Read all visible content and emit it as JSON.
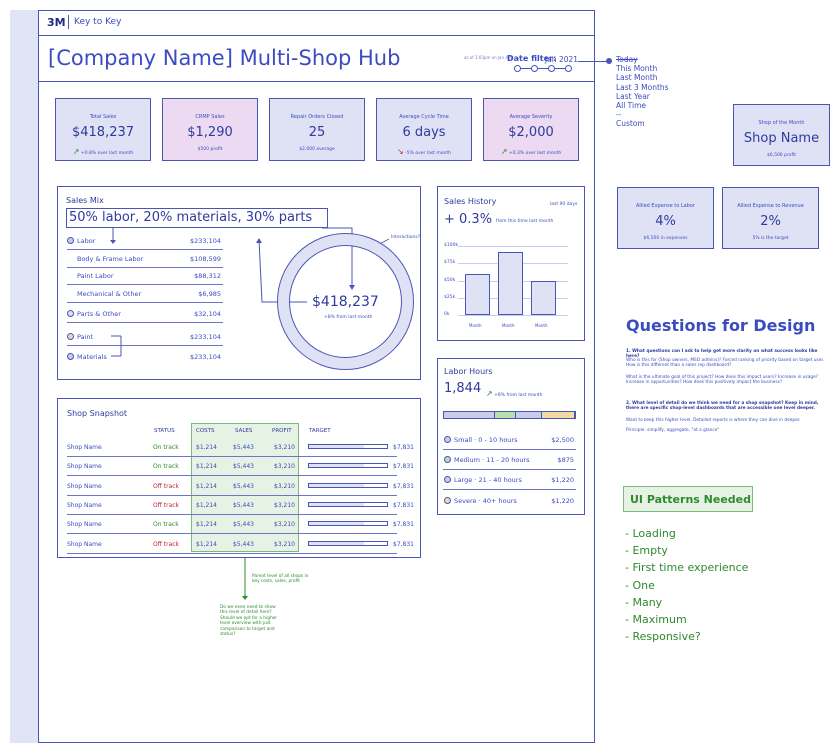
{
  "header": {
    "brand": "3M",
    "subtitle": "Key to Key"
  },
  "hub": {
    "title": "[Company Name] Multi-Shop Hub"
  },
  "date_filter": {
    "hint": "as of 3:03pm on Jan 4th",
    "label": "Date filter:",
    "value": "Jan 2021",
    "options": [
      "Today",
      "This Month",
      "Last Month",
      "Last 3 Months",
      "Last Year",
      "All Time",
      "--",
      "Custom"
    ]
  },
  "kpis": [
    {
      "label": "Total Sales",
      "value": "$418,237",
      "sub": "+0.8% over last month",
      "trend": "up"
    },
    {
      "label": "CRMP Sales",
      "value": "$1,290",
      "sub": "$500 profit",
      "trend": ""
    },
    {
      "label": "Repair Orders Closed",
      "value": "25",
      "sub": "$2,000 average",
      "trend": ""
    },
    {
      "label": "Average Cycle Time",
      "value": "6 days",
      "sub": "-5% over last month",
      "trend": "down"
    },
    {
      "label": "Average Severity",
      "value": "$2,000",
      "sub": "+0.3% over last month",
      "trend": "up"
    }
  ],
  "side_kpis": [
    {
      "label": "Shop of the Month",
      "value": "Shop Name",
      "sub": "$6,500 profit"
    },
    {
      "label": "Allied Expense to Labor",
      "value": "4%",
      "sub": "$6,500 in expenses"
    },
    {
      "label": "Allied Expense to Revenue",
      "value": "2%",
      "sub": "5% is the target"
    }
  ],
  "sales_mix": {
    "title": "Sales Mix",
    "headline": "50% labor, 20% materials, 30% parts",
    "rows": [
      {
        "label": "Labor",
        "value": "$233,104"
      },
      {
        "label": "Body & Frame Labor",
        "value": "$108,599"
      },
      {
        "label": "Paint Labor",
        "value": "$88,312"
      },
      {
        "label": "Mechanical & Other",
        "value": "$6,985"
      },
      {
        "label": "Parts & Other",
        "value": "$32,104"
      },
      {
        "label": "Paint",
        "value": "$233,104"
      },
      {
        "label": "Materials",
        "value": "$233,104"
      }
    ],
    "total": "$418,237",
    "total_sub": "+8% from last month",
    "note": "Interactions?"
  },
  "sales_history": {
    "title": "Sales History",
    "range": "last 90 days",
    "value": "+ 0.3%",
    "sub": "from this time last month",
    "yticks": [
      "$100k",
      "$75k",
      "$50k",
      "$25k",
      "0k"
    ],
    "chart_data": {
      "type": "bar",
      "categories": [
        "Month",
        "Month",
        "Month"
      ],
      "values": [
        60,
        92,
        50
      ],
      "ylim": [
        0,
        100
      ],
      "ylabel": "",
      "xlabel": ""
    }
  },
  "labor_hours": {
    "title": "Labor Hours",
    "value": "1,844",
    "sub": "+8% from last month",
    "segments": [
      {
        "color": "#c9cdeb",
        "share": 0.39
      },
      {
        "color": "#b7e0b0",
        "share": 0.16
      },
      {
        "color": "#c9cdeb",
        "share": 0.2
      },
      {
        "color": "#f3d9a6",
        "share": 0.25
      }
    ],
    "rows": [
      {
        "label": "Small",
        "range": "0 - 10 hours",
        "value": "$2,500",
        "color": "#c9cdeb"
      },
      {
        "label": "Medium",
        "range": "11 - 20 hours",
        "value": "$875",
        "color": "#b7e0b0"
      },
      {
        "label": "Large",
        "range": "21 - 40 hours",
        "value": "$1,220",
        "color": "#c9cdeb"
      },
      {
        "label": "Severe",
        "range": "40+ hours",
        "value": "$1,220",
        "color": "#f3d9a6"
      }
    ]
  },
  "snapshot": {
    "title": "Shop Snapshot",
    "headers": {
      "status": "STATUS",
      "costs": "COSTS",
      "sales": "SALES",
      "profit": "PROFIT",
      "target": "TARGET"
    },
    "rows": [
      {
        "name": "Shop Name",
        "status": "On track",
        "costs": "$1,214",
        "sales": "$5,443",
        "profit": "$3,210",
        "target": "$7,831",
        "progress": 0.7
      },
      {
        "name": "Shop Name",
        "status": "On track",
        "costs": "$1,214",
        "sales": "$5,443",
        "profit": "$3,210",
        "target": "$7,831",
        "progress": 0.7
      },
      {
        "name": "Shop Name",
        "status": "Off track",
        "costs": "$1,214",
        "sales": "$5,443",
        "profit": "$3,210",
        "target": "$7,831",
        "progress": 0.7
      },
      {
        "name": "Shop Name",
        "status": "Off track",
        "costs": "$1,214",
        "sales": "$5,443",
        "profit": "$3,210",
        "target": "$7,831",
        "progress": 0.7
      },
      {
        "name": "Shop Name",
        "status": "On track",
        "costs": "$1,214",
        "sales": "$5,443",
        "profit": "$3,210",
        "target": "$7,831",
        "progress": 0.7
      },
      {
        "name": "Shop Name",
        "status": "Off track",
        "costs": "$1,214",
        "sales": "$5,443",
        "profit": "$3,210",
        "target": "$7,831",
        "progress": 0.7
      }
    ],
    "note1": "Parent level of all shops in key costs, sales, profit",
    "note2": "Do we even need to show this level of detail here? Should we opt for a higher level overview with just comparison to target and status?"
  },
  "questions": {
    "title": "Questions for Design",
    "q1": "1. What questions can I ask to help get more clarity on what success looks like here?",
    "q1a": "Who is this for (Shop owners, MSO admins)? Forced ranking of priority based on target user. How is this different than a sales rep dashboard?",
    "q1b": "What is the ultimate goal of this project? How does this impact users? Increase in usage? Increase in opportunities? How does this positively impact the business?",
    "q2": "2. What level of detail do we think we need for a shop snapshot? Keep in mind, there are specific shop-level dashboards that are accessible one level deeper.",
    "q2a": "Want to keep this higher level. Detailed reports is where they can dive in deeper.",
    "q2b": "Principle: simplify, aggregate, \"at a glance\""
  },
  "ui_patterns": {
    "title": "UI Patterns Needed",
    "items": [
      "- Loading",
      "- Empty",
      "- First time experience",
      "- One",
      "- Many",
      "- Maximum",
      "- Responsive?"
    ]
  }
}
